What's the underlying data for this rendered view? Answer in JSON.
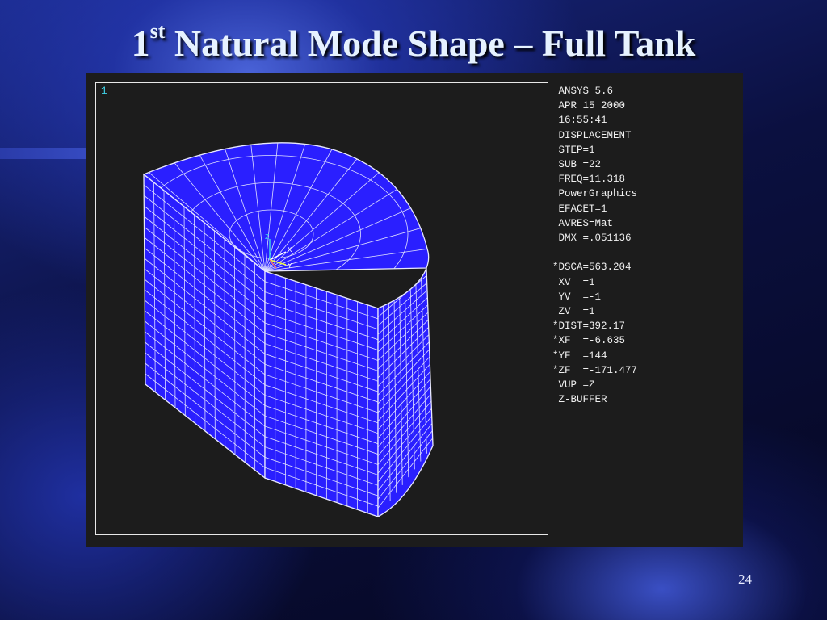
{
  "slide": {
    "title_prefix": "1",
    "title_sup": "st",
    "title_rest": " Natural Mode Shape – Full Tank",
    "page_number": "24"
  },
  "viewport": {
    "window_number": "1",
    "triad_labels": [
      "Z",
      "X",
      "Y"
    ],
    "mesh_color": "#2a1fff",
    "info": [
      " ANSYS 5.6",
      " APR 15 2000",
      " 16:55:41",
      " DISPLACEMENT",
      " STEP=1",
      " SUB =22",
      " FREQ=11.318",
      " PowerGraphics",
      " EFACET=1",
      " AVRES=Mat",
      " DMX =.051136",
      "",
      "*DSCA=563.204",
      " XV  =1",
      " YV  =-1",
      " ZV  =1",
      "*DIST=392.17",
      "*XF  =-6.635",
      "*YF  =144",
      "*ZF  =-171.477",
      " VUP =Z",
      " Z-BUFFER"
    ]
  }
}
